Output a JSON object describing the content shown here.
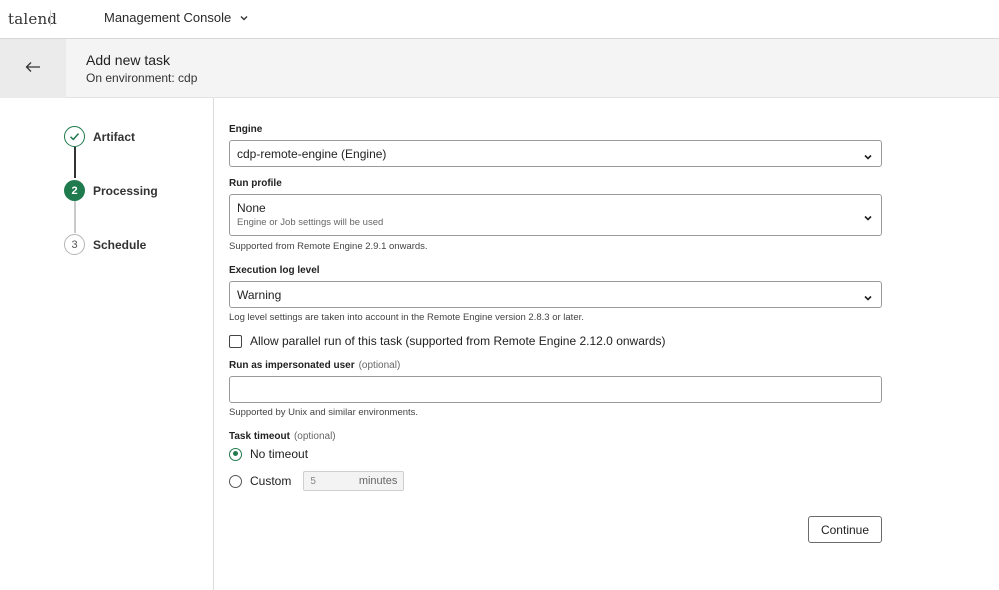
{
  "topbar": {
    "logo": "talend",
    "app_name": "Management Console"
  },
  "header": {
    "title": "Add new task",
    "subtitle": "On environment: cdp"
  },
  "stepper": {
    "steps": [
      {
        "number": "1",
        "label": "Artifact",
        "state": "done"
      },
      {
        "number": "2",
        "label": "Processing",
        "state": "active"
      },
      {
        "number": "3",
        "label": "Schedule",
        "state": "todo"
      }
    ]
  },
  "form": {
    "engine": {
      "label": "Engine",
      "value": "cdp-remote-engine (Engine)"
    },
    "run_profile": {
      "label": "Run profile",
      "value": "None",
      "description": "Engine or Job settings will be used",
      "hint": "Supported from Remote Engine 2.9.1 onwards."
    },
    "log_level": {
      "label": "Execution log level",
      "value": "Warning",
      "hint": "Log level settings are taken into account in the Remote Engine version 2.8.3 or later."
    },
    "parallel_run": {
      "label": "Allow parallel run of this task (supported from Remote Engine 2.12.0 onwards)",
      "checked": false
    },
    "impersonated_user": {
      "label": "Run as impersonated user",
      "optional": "(optional)",
      "value": "",
      "hint": "Supported by Unix and similar environments."
    },
    "task_timeout": {
      "label": "Task timeout",
      "optional": "(optional)",
      "options": [
        {
          "label": "No timeout",
          "checked": true
        },
        {
          "label": "Custom",
          "checked": false
        }
      ],
      "custom_value": "5",
      "custom_unit": "minutes"
    },
    "continue_label": "Continue"
  },
  "colors": {
    "accent": "#1f7a4d",
    "header_bg": "#f4f4f4"
  }
}
